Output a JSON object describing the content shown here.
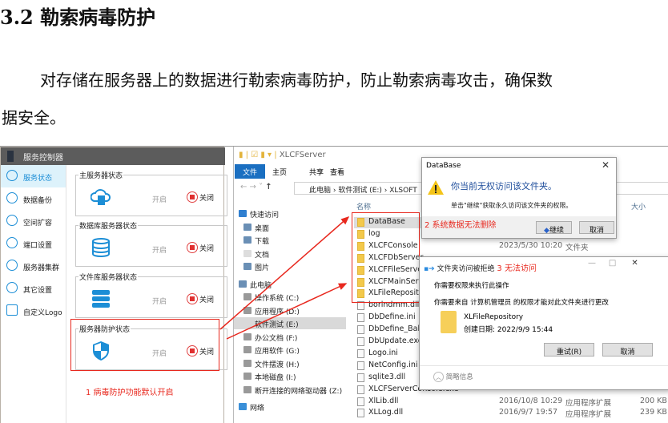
{
  "heading": "3.2 勒索病毒防护",
  "paragraph_line1": "对存储在服务器上的数据进行勒索病毒防护，防止勒索病毒攻击，确保数",
  "paragraph_line2": "据安全。",
  "controller": {
    "title": "服务控制器",
    "sidebar": [
      {
        "label": "服务状态",
        "icon": "link-icon"
      },
      {
        "label": "数据备份",
        "icon": "backup-icon"
      },
      {
        "label": "空间扩容",
        "icon": "cloud-icon"
      },
      {
        "label": "端口设置",
        "icon": "chain-icon"
      },
      {
        "label": "服务器集群",
        "icon": "cluster-icon"
      },
      {
        "label": "其它设置",
        "icon": "gear-icon"
      },
      {
        "label": "自定义Logo",
        "icon": "edit-icon"
      }
    ],
    "groups": [
      {
        "title": "主服务器状态",
        "on": "开启",
        "off": "关闭",
        "icon": "cloud-server-icon"
      },
      {
        "title": "数据库服务器状态",
        "on": "开启",
        "off": "关闭",
        "icon": "database-icon"
      },
      {
        "title": "文件库服务器状态",
        "on": "开启",
        "off": "关闭",
        "icon": "server-icon"
      },
      {
        "title": "服务器防护状态",
        "on": "开启",
        "off": "关闭",
        "icon": "shield-icon"
      }
    ],
    "annotation": "1 病毒防护功能默认开启"
  },
  "explorer": {
    "title": "XLCFServer",
    "tabs": [
      "文件",
      "主页",
      "共享",
      "查看"
    ],
    "breadcrumb": "此电脑  ›  软件测试 (E:)  ›  XLSOFT",
    "nav": [
      "快速访问",
      "桌面",
      "下载",
      "文档",
      "图片",
      "此电脑",
      "操作系统 (C:)",
      "应用程序 (D:)",
      "软件测试 (E:)",
      "办公文档 (F:)",
      "应用软件 (G:)",
      "文件摆渡 (H:)",
      "本地磁盘 (I:)",
      "断开连接的网络驱动器 (Z:)",
      "网络"
    ],
    "columns": {
      "name": "名称",
      "size": "大小"
    },
    "files": [
      {
        "name": "DataBase",
        "folder": true
      },
      {
        "name": "log",
        "folder": true
      },
      {
        "name": "XLCFConsole",
        "folder": true,
        "date": "2023/5/30 10:20",
        "type": "文件夹"
      },
      {
        "name": "XLCFDbServer",
        "folder": true
      },
      {
        "name": "XLCFFileServer",
        "folder": true
      },
      {
        "name": "XLCFMainServer",
        "folder": true
      },
      {
        "name": "XLFileRepository",
        "folder": true
      },
      {
        "name": "borlndmm.dll"
      },
      {
        "name": "DbDefine.ini"
      },
      {
        "name": "DbDefine_Bak.ini"
      },
      {
        "name": "DbUpdate.exe"
      },
      {
        "name": "Logo.ini"
      },
      {
        "name": "NetConfig.ini"
      },
      {
        "name": "sqlite3.dll"
      },
      {
        "name": "XLCFServerConsole.exe"
      },
      {
        "name": "XlLib.dll",
        "date": "2016/10/8 10:29",
        "type": "应用程序扩展",
        "size": "200 KB"
      },
      {
        "name": "XLLog.dll",
        "date": "2016/9/7 19:57",
        "type": "应用程序扩展",
        "size": "239 KB"
      }
    ],
    "annotation": "2 系统数据无法删除"
  },
  "dialog1": {
    "title": "DataBase",
    "message": "你当前无权访问该文件夹。",
    "detail": "单击\"继续\"获取永久访问该文件夹的权限。",
    "continue": "继续",
    "cancel": "取消"
  },
  "dialog2": {
    "title": "文件夹访问被拒绝",
    "annotation": "3 无法访问",
    "line1": "你需要权限来执行此操作",
    "line2": "你需要来自 计算机管理员 的权限才能对此文件夹进行更改",
    "folder_name": "XLFileRepository",
    "created": "创建日期: 2022/9/9 15:44",
    "retry": "重试(R)",
    "cancel": "取消",
    "details": "简略信息"
  },
  "colors": {
    "accent": "#1c8ed6",
    "annotation": "#e8281e"
  }
}
